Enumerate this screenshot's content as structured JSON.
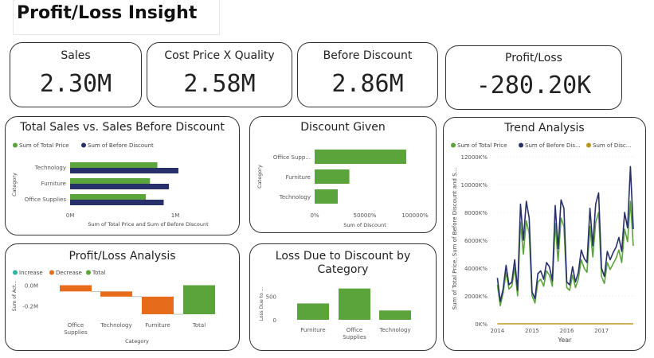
{
  "page": {
    "title": "Profit/Loss Insight"
  },
  "kpis": [
    {
      "label": "Sales",
      "value": "2.30M"
    },
    {
      "label": "Cost Price X Quality",
      "value": "2.58M"
    },
    {
      "label": "Before Discount",
      "value": "2.86M"
    },
    {
      "label": "Profit/Loss",
      "value": "-280.20K"
    }
  ],
  "colors": {
    "green": "#5ba33b",
    "navy": "#27306b",
    "orange": "#e66c1c",
    "teal": "#2bb3a3",
    "gold": "#b8961e"
  },
  "chart_data": [
    {
      "id": "sales_vs_before",
      "type": "bar",
      "title": "Total Sales vs. Sales Before Discount",
      "legend": [
        "Sum of Total Price",
        "Sum of Before Discount"
      ],
      "categories": [
        "Technology",
        "Furniture",
        "Office Supplies"
      ],
      "series": [
        {
          "name": "Sum of Total Price",
          "values": [
            0.83,
            0.76,
            0.72
          ]
        },
        {
          "name": "Sum of Before Discount",
          "values": [
            1.03,
            0.94,
            0.89
          ]
        }
      ],
      "x_ticks": [
        "0M",
        "1M"
      ],
      "xlabel": "Sum of Total Price and Sum of Before Discount",
      "ylabel": "Category",
      "xlim": [
        0,
        1.0
      ]
    },
    {
      "id": "discount_given",
      "type": "bar",
      "title": "Discount Given",
      "categories": [
        "Office Supp...",
        "Furniture",
        "Technology"
      ],
      "values": [
        95000,
        36000,
        24000
      ],
      "x_ticks": [
        "0%",
        "50000%",
        "100000%"
      ],
      "xlabel": "Sum of Discount",
      "ylabel": "Category",
      "xlim": [
        0,
        100000
      ]
    },
    {
      "id": "profit_loss",
      "type": "bar",
      "subtype": "waterfall",
      "title": "Profit/Loss Analysis",
      "legend": [
        "Increase",
        "Decrease",
        "Total"
      ],
      "categories": [
        "Office Supplies",
        "Technology",
        "Furniture",
        "Total"
      ],
      "values": [
        -0.06,
        -0.05,
        -0.17,
        -0.28
      ],
      "y_ticks": [
        "0.0M",
        "-0.2M"
      ],
      "xlabel": "Category",
      "ylabel": "Sum of Act...",
      "ylim": [
        -0.28,
        0.05
      ]
    },
    {
      "id": "loss_due_discount",
      "type": "bar",
      "title": "Loss Due to Discount by Category",
      "categories": [
        "Furniture",
        "Office Supplies",
        "Technology"
      ],
      "values": [
        350,
        670,
        200
      ],
      "y_ticks": [
        "500",
        "0"
      ],
      "ylabel": "Loss Due to ...",
      "ylim": [
        0,
        800
      ]
    },
    {
      "id": "trend",
      "type": "line",
      "title": "Trend Analysis",
      "legend": [
        "Sum of Total Price",
        "Sum of Before Dis...",
        "Sum of Disc..."
      ],
      "x_ticks": [
        "2014",
        "2015",
        "2016",
        "2017"
      ],
      "y_ticks": [
        "12000K%",
        "10000K%",
        "8000K%",
        "6000K%",
        "4000K%",
        "2000K%",
        "0K%"
      ],
      "xlabel": "Year",
      "ylabel": "Sum of Total Price, Sum of Before Discount and S...",
      "ylim": [
        0,
        12000
      ],
      "xlim": [
        2013.9,
        2017.96
      ],
      "series": [
        {
          "name": "Sum of Total Price",
          "x_start": 2014,
          "step": 0.0833,
          "values": [
            2800,
            1300,
            2200,
            3700,
            2500,
            2700,
            4000,
            2000,
            7300,
            5000,
            7400,
            6500,
            2000,
            1500,
            3000,
            3200,
            2700,
            3800,
            3500,
            2700,
            7200,
            4500,
            7600,
            7000,
            2600,
            2400,
            3500,
            2600,
            3200,
            4600,
            4000,
            3700,
            7000,
            4800,
            7300,
            8000,
            3400,
            2900,
            4400,
            3900,
            4300,
            4700,
            5300,
            4400,
            6800,
            5900,
            8800,
            5600
          ]
        },
        {
          "name": "Sum of Before Dis...",
          "x_start": 2014,
          "step": 0.0833,
          "values": [
            3300,
            1600,
            2500,
            4200,
            2800,
            3000,
            4600,
            2400,
            8600,
            6000,
            8800,
            7600,
            2300,
            1800,
            3600,
            3800,
            3200,
            4400,
            4100,
            3100,
            8500,
            5400,
            8900,
            8300,
            3000,
            2800,
            4100,
            3000,
            3700,
            5300,
            4700,
            4400,
            8300,
            5600,
            8600,
            9400,
            4000,
            3400,
            5200,
            4600,
            5100,
            5500,
            6200,
            5200,
            8000,
            6900,
            11300,
            6800
          ]
        },
        {
          "name": "Sum of Disc...",
          "x_start": 2014,
          "step": 0.0833,
          "values": [
            0,
            0,
            0,
            0,
            0,
            0,
            0,
            0,
            0,
            0,
            0,
            0,
            0,
            0,
            0,
            0,
            0,
            0,
            0,
            0,
            0,
            0,
            0,
            0,
            0,
            0,
            0,
            0,
            0,
            0,
            0,
            0,
            0,
            0,
            0,
            0,
            0,
            0,
            0,
            0,
            0,
            0,
            0,
            0,
            0,
            0,
            0,
            0
          ]
        }
      ]
    }
  ]
}
